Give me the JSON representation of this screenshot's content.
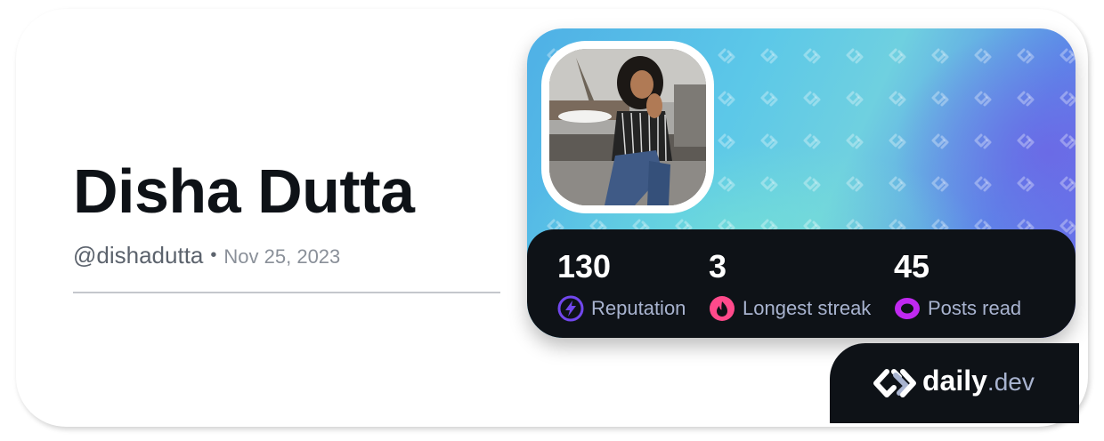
{
  "profile": {
    "name": "Disha Dutta",
    "handle": "@dishadutta",
    "separator": "•",
    "joined": "Nov 25, 2023"
  },
  "stats": [
    {
      "value": "130",
      "label": "Reputation",
      "icon": "lightning-icon",
      "color": "#7147ed"
    },
    {
      "value": "3",
      "label": "Longest streak",
      "icon": "flame-icon",
      "color": "#ff4a8b"
    },
    {
      "value": "45",
      "label": "Posts read",
      "icon": "eye-icon",
      "color": "#c029f0"
    }
  ],
  "brand": {
    "name": "daily",
    "suffix": ".dev",
    "icon": "daily-dev-logo-icon"
  },
  "colors": {
    "text_primary": "#0e1217",
    "text_secondary": "#5c636d",
    "panel_dark": "#0e1217",
    "label_muted": "#a8b3cf"
  }
}
